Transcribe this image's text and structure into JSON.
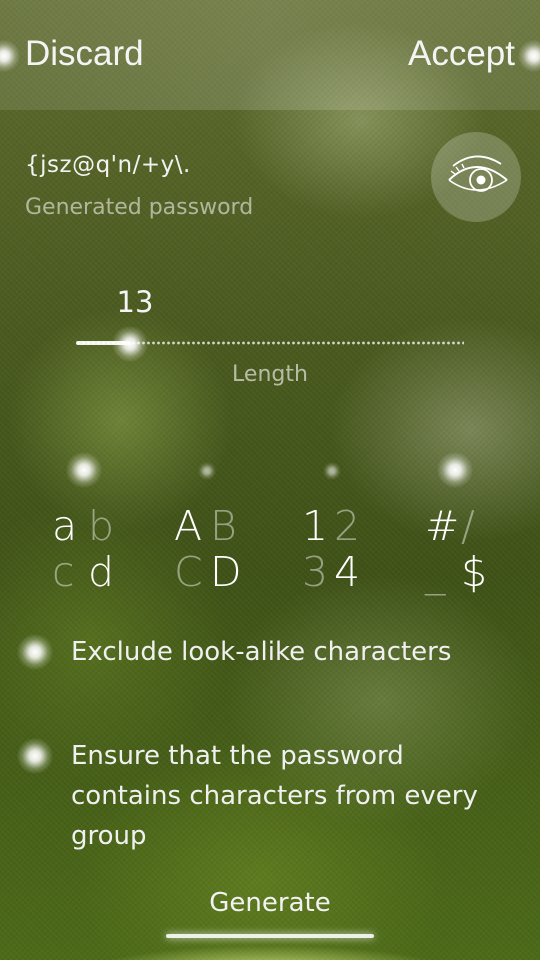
{
  "header": {
    "discard_label": "Discard",
    "accept_label": "Accept"
  },
  "password": {
    "value": "{jsz@q'n/+y\\.",
    "label": "Generated password",
    "toggle_icon": "eye-icon"
  },
  "length_slider": {
    "value": "13",
    "label": "Length",
    "fraction": 0.14
  },
  "char_groups": [
    {
      "name": "lowercase",
      "chars": [
        "a",
        "b",
        "c",
        "d"
      ],
      "highlight": [
        true,
        false,
        false,
        true
      ],
      "enabled": true
    },
    {
      "name": "uppercase",
      "chars": [
        "A",
        "B",
        "C",
        "D"
      ],
      "highlight": [
        true,
        false,
        false,
        true
      ],
      "enabled": false
    },
    {
      "name": "digits",
      "chars": [
        "1",
        "2",
        "3",
        "4"
      ],
      "highlight": [
        true,
        false,
        false,
        true
      ],
      "enabled": false
    },
    {
      "name": "symbols",
      "chars": [
        "#",
        "/",
        "_",
        "$"
      ],
      "highlight": [
        true,
        false,
        false,
        true
      ],
      "enabled": true
    }
  ],
  "options": {
    "exclude_lookalike": {
      "label": "Exclude look-alike characters",
      "checked": true
    },
    "ensure_groups": {
      "label_lines": [
        "Ensure that the password",
        "contains characters from every",
        "group"
      ],
      "checked": true
    }
  },
  "generate_label": "Generate",
  "colors": {
    "text": "#ffffff",
    "dim_text": "rgba(255,255,255,0.45)",
    "background_green": "#4a5a1f"
  }
}
